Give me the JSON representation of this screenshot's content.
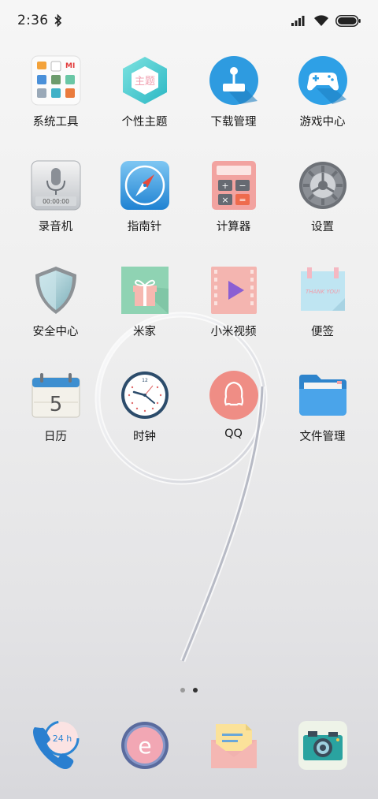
{
  "status_bar": {
    "time": "2:36",
    "battery_level": 1.0
  },
  "apps": [
    {
      "id": "system-tools",
      "label": "系统工具",
      "icon": "folder-grid-icon"
    },
    {
      "id": "themes",
      "label": "个性主题",
      "icon": "theme-hexagon-icon",
      "icon_text": "主题"
    },
    {
      "id": "downloads",
      "label": "下载管理",
      "icon": "joystick-download-icon"
    },
    {
      "id": "game-center",
      "label": "游戏中心",
      "icon": "gamepad-icon"
    },
    {
      "id": "recorder",
      "label": "录音机",
      "icon": "microphone-icon",
      "icon_text": "00:00:00"
    },
    {
      "id": "compass",
      "label": "指南针",
      "icon": "compass-icon"
    },
    {
      "id": "calculator",
      "label": "计算器",
      "icon": "calculator-icon"
    },
    {
      "id": "settings",
      "label": "设置",
      "icon": "gear-icon"
    },
    {
      "id": "security",
      "label": "安全中心",
      "icon": "shield-icon"
    },
    {
      "id": "mijia",
      "label": "米家",
      "icon": "gift-icon"
    },
    {
      "id": "mi-video",
      "label": "小米视频",
      "icon": "play-film-icon"
    },
    {
      "id": "notes",
      "label": "便签",
      "icon": "sticky-note-icon",
      "icon_text": "THANK YOU!"
    },
    {
      "id": "calendar",
      "label": "日历",
      "icon": "calendar-icon",
      "icon_text": "5"
    },
    {
      "id": "clock",
      "label": "时钟",
      "icon": "clock-icon",
      "icon_text": "12"
    },
    {
      "id": "qq",
      "label": "QQ",
      "icon": "qq-penguin-icon"
    },
    {
      "id": "file-manager",
      "label": "文件管理",
      "icon": "folder-icon"
    }
  ],
  "pages": {
    "current": 2,
    "total": 2
  },
  "dock": [
    {
      "id": "phone",
      "icon": "phone-icon",
      "icon_text": "24 h"
    },
    {
      "id": "browser",
      "icon": "browser-icon",
      "icon_text": "e"
    },
    {
      "id": "messages",
      "icon": "message-envelope-icon"
    },
    {
      "id": "camera",
      "icon": "camera-icon"
    }
  ]
}
